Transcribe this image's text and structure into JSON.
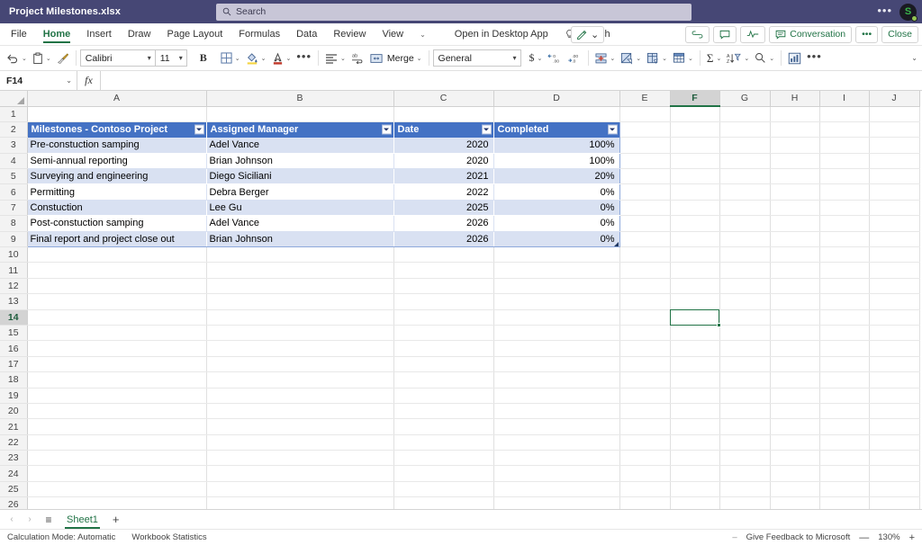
{
  "titlebar": {
    "filename": "Project Milestones.xlsx",
    "search_placeholder": "Search",
    "more_options": "•••",
    "avatar_initial": "S"
  },
  "ribbon": {
    "tabs": [
      {
        "label": "File",
        "active": false
      },
      {
        "label": "Home",
        "active": true
      },
      {
        "label": "Insert",
        "active": false
      },
      {
        "label": "Draw",
        "active": false
      },
      {
        "label": "Page Layout",
        "active": false
      },
      {
        "label": "Formulas",
        "active": false
      },
      {
        "label": "Data",
        "active": false
      },
      {
        "label": "Review",
        "active": false
      },
      {
        "label": "View",
        "active": false
      }
    ],
    "tabs_overflow_caret": "⌄",
    "open_in_desktop": "Open in Desktop App",
    "search": "Search",
    "editing_mode_caret": "⌄",
    "conversation": "Conversation",
    "more": "•••",
    "close": "Close"
  },
  "toolbar": {
    "undo_caret": "⌄",
    "paste_caret": "⌄",
    "font_name": "Calibri",
    "font_size": "11",
    "bold": "B",
    "borders_caret": "⌄",
    "fill_caret": "⌄",
    "fontcolor_caret": "⌄",
    "font_more": "•••",
    "align_caret": "⌄",
    "merge_label": "Merge",
    "merge_caret": "⌄",
    "number_format": "General",
    "currency_caret": "⌄",
    "insert_caret": "⌄",
    "format_caret": "⌄",
    "cellstyles_caret": "⌄",
    "tablestyles_caret": "⌄",
    "autosum_caret": "⌄",
    "sortfilter_caret": "⌄",
    "find_caret": "⌄",
    "more": "•••",
    "collapse_caret": "⌄"
  },
  "formulabar": {
    "namebox_value": "F14",
    "namebox_caret": "⌄",
    "fx_label": "fx",
    "formula_value": ""
  },
  "grid": {
    "columns": [
      "A",
      "B",
      "C",
      "D",
      "E",
      "F",
      "G",
      "H",
      "I",
      "J"
    ],
    "selected_column": "F",
    "selected_row": 14,
    "selected_cell": "F14",
    "rows": [
      1,
      2,
      3,
      4,
      5,
      6,
      7,
      8,
      9,
      10,
      11,
      12,
      13,
      14,
      15,
      16,
      17,
      18,
      19,
      20,
      21,
      22,
      23,
      24,
      25,
      26
    ],
    "table": {
      "header_row": 2,
      "headers": [
        "Milestones - Contoso Project",
        "Assigned Manager",
        "Date",
        "Completed"
      ],
      "records": [
        {
          "row": 3,
          "milestone": "Pre-constuction samping",
          "manager": "Adel Vance",
          "date": "2020",
          "completed": "100%"
        },
        {
          "row": 4,
          "milestone": "Semi-annual reporting",
          "manager": "Brian Johnson",
          "date": "2020",
          "completed": "100%"
        },
        {
          "row": 5,
          "milestone": "Surveying and engineering",
          "manager": "Diego Siciliani",
          "date": "2021",
          "completed": "20%"
        },
        {
          "row": 6,
          "milestone": "Permitting",
          "manager": "Debra Berger",
          "date": "2022",
          "completed": "0%"
        },
        {
          "row": 7,
          "milestone": "Constuction",
          "manager": "Lee Gu",
          "date": "2025",
          "completed": "0%"
        },
        {
          "row": 8,
          "milestone": "Post-constuction samping",
          "manager": "Adel Vance",
          "date": "2026",
          "completed": "0%"
        },
        {
          "row": 9,
          "milestone": "Final report and project close out",
          "manager": "Brian Johnson",
          "date": "2026",
          "completed": "0%"
        }
      ]
    },
    "colors": {
      "table_header_bg": "#4472C4",
      "table_band_bg": "#D9E1F2",
      "table_border": "#8EA9DB",
      "selection": "#217346"
    }
  },
  "sheetbar": {
    "prev": "‹",
    "next": "›",
    "all_sheets": "≡",
    "tabs": [
      {
        "label": "Sheet1",
        "active": true
      }
    ],
    "add": "+"
  },
  "statusbar": {
    "calculation_mode": "Calculation Mode: Automatic",
    "workbook_statistics": "Workbook Statistics",
    "dash": "–",
    "feedback": "Give Feedback to Microsoft",
    "zoom_out": "—",
    "zoom_level": "130%",
    "zoom_in": "+"
  }
}
